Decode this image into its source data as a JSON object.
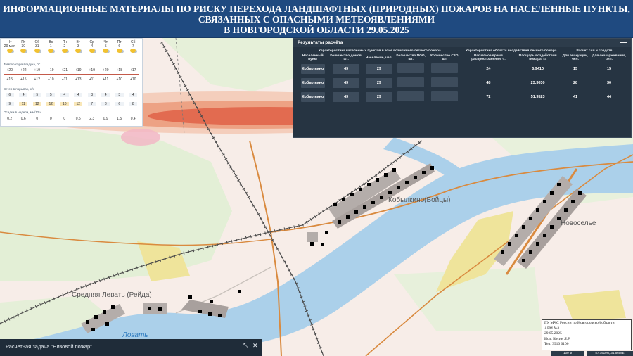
{
  "title": {
    "line1": "ИНФОРМАЦИОННЫЕ МАТЕРИАЛЫ ПО РИСКУ ПЕРЕХОДА ЛАНДШАФТНЫХ (ПРИРОДНЫХ) ПОЖАРОВ НА НАСЕЛЕННЫЕ ПУНКТЫ,",
    "line2": "СВЯЗАННЫХ С ОПАСНЫМИ МЕТЕОЯВЛЕНИЯМИ",
    "line3": "В НОВГОРОДСКОЙ ОБЛАСТИ 29.05.2025"
  },
  "forecast": {
    "days": [
      "Чт",
      "Пт",
      "Сб",
      "Вс",
      "Пн",
      "Вт",
      "Ср",
      "Чт",
      "Пт",
      "Сб"
    ],
    "dates": [
      "29 мая",
      "30",
      "31",
      "1",
      "2",
      "3",
      "4",
      "5",
      "6",
      "7"
    ],
    "temp_label": "Температура воздуха, °C",
    "temps_max": [
      "+20",
      "+22",
      "+19",
      "+19",
      "+21",
      "+19",
      "+19",
      "+20",
      "+18",
      "+17"
    ],
    "temps_min": [
      "+15",
      "+15",
      "+12",
      "+10",
      "+11",
      "+13",
      "+11",
      "+11",
      "+10",
      "+10"
    ],
    "wind_label": "Ветер в порывах, м/с",
    "wind": [
      "6",
      "4",
      "5",
      "5",
      "4",
      "4",
      "3",
      "4",
      "3",
      "4"
    ],
    "gusts": [
      "9",
      "11",
      "12",
      "12",
      "10",
      "12",
      "7",
      "8",
      "6",
      "8"
    ],
    "prec_label": "Осадки в недели, мм/12 ч",
    "prec": [
      "0,2",
      "0,6",
      "0",
      "0",
      "0",
      "0,5",
      "2,3",
      "0,9",
      "1,5",
      "0,4"
    ]
  },
  "results": {
    "title": "Результаты расчёта",
    "minimize": "—",
    "group_headers": [
      "Характеристика населенных пунктов в зоне возможного лесного пожара",
      "Характеристика области воздействия лесного пожара",
      "Расчет сил и средств"
    ],
    "columns": [
      "Населенный пункт",
      "Количество домов, шт.",
      "Население, чел.",
      "Количество ПОО, шт.",
      "Количество СЗО, шт.",
      "Расчетное время распространения, ч.",
      "Площадь воздействия пожара, га",
      "Для эвакуации, чел.",
      "Для оказарживания, чел."
    ],
    "rows": [
      [
        "Кобылкино",
        "49",
        "29",
        "",
        "",
        "24",
        "5.9410",
        "15",
        "15"
      ],
      [
        "Кобылкино",
        "49",
        "29",
        "",
        "",
        "48",
        "23.3030",
        "28",
        "30"
      ],
      [
        "Кобылкино",
        "49",
        "29",
        "",
        "",
        "72",
        "51.9523",
        "41",
        "44"
      ]
    ]
  },
  "map_labels": {
    "village_main": "Кобылкино(Бойцы)",
    "village_east": "Новоселье",
    "village_west": "Средняя Левать (Рейда)",
    "river": "Ловать"
  },
  "stamp": {
    "line1": "ГУ МЧС России по Новгородской области",
    "line2": "АРМ №3",
    "line3": "29.05.2025",
    "line4": "Исп. Косин Я.Р.",
    "line5": "Тел. 3910 0100"
  },
  "task": {
    "label": "Расчетная задача \"Низовой пожар\"",
    "expand": "⤡",
    "close": "✕"
  },
  "status": {
    "scale": "100 м",
    "coords": "57.7910N, 31.6658E"
  },
  "colors": {
    "title_bg": "#1f4a80",
    "panel_bg": "#263442",
    "river": "#aacfe9",
    "land": "#f6ece6",
    "forest": "#e2eed4",
    "fire_zone": "#e0654a",
    "field": "#efe49a",
    "road": "#d98a3f"
  }
}
